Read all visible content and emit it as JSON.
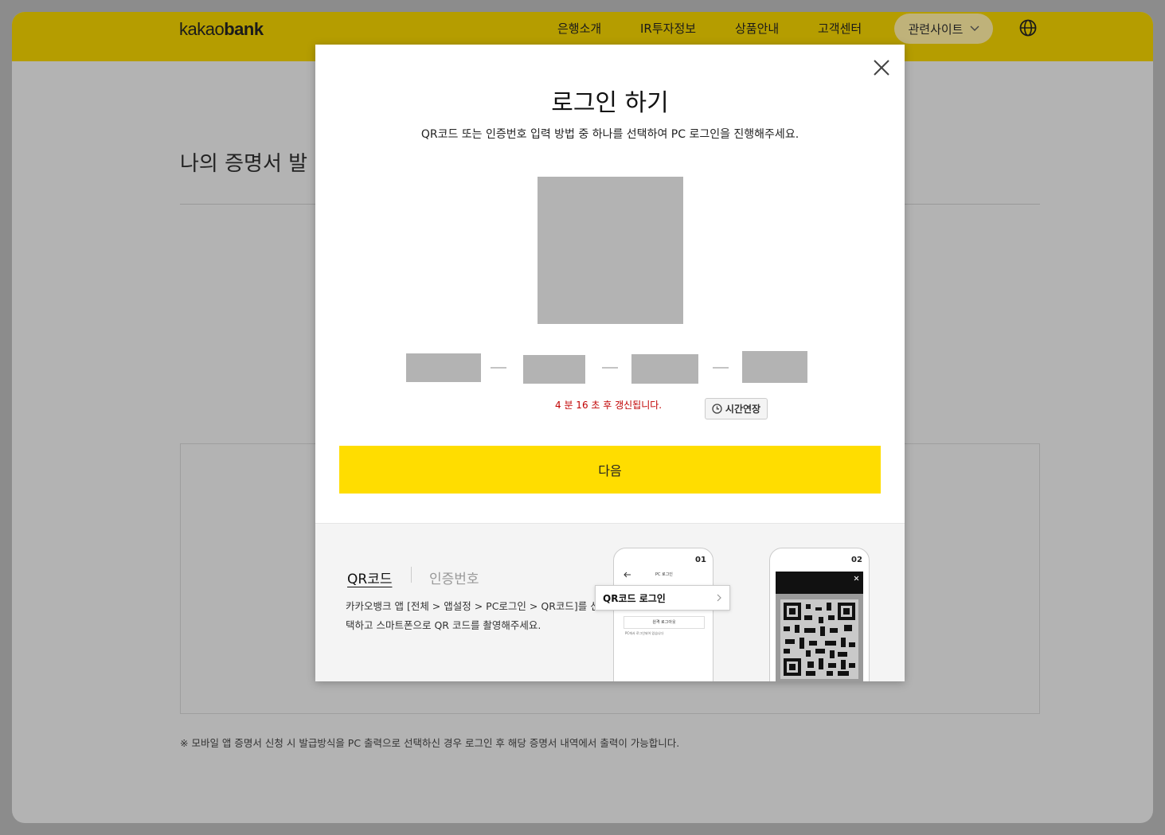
{
  "header": {
    "logo_light": "kakao",
    "logo_bold": "bank",
    "nav": [
      "은행소개",
      "IR투자정보",
      "상품안내",
      "고객센터"
    ],
    "related_sites": "관련사이트"
  },
  "page": {
    "title": "나의 증명서 발",
    "footnote": "※ 모바일 앱 증명서 신청 시 발급방식을 PC 출력으로 선택하신 경우 로그인 후 해당 증명서 내역에서 출력이 가능합니다."
  },
  "modal": {
    "title": "로그인 하기",
    "subtitle": "QR코드 또는 인증번호 입력 방법 중 하나를 선택하여 PC 로그인을 진행해주세요.",
    "timer_text": "4 분 16 초 후 갱신됩니다.",
    "extend_label": "시간연장",
    "next_label": "다음",
    "tabs": {
      "qr": "QR코드",
      "code": "인증번호"
    },
    "guide_text": "카카오뱅크 앱 [전체 > 앱설정 > PC로그인 > QR코드]를 선택하고 스마트폰으로 QR 코드를 촬영해주세요.",
    "steps": {
      "one": "01",
      "two": "02"
    },
    "popup_label": "QR코드 로그인",
    "phone1_header": "PC 로그인",
    "phone1_button": "원격 로그아웃",
    "phone1_note": "PC에서 로그인되어 있습니다"
  },
  "colors": {
    "accent": "#ffdd00",
    "header_dim": "#b59d00",
    "timer": "#c00000"
  }
}
